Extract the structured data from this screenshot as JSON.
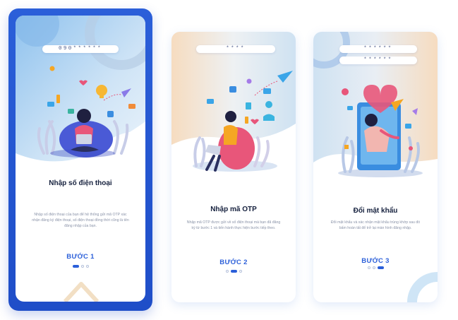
{
  "colors": {
    "accent": "#2b5fd9",
    "title": "#16213e",
    "muted": "#8a93a8"
  },
  "steps": [
    {
      "input_value": "090******",
      "title": "Nhập số điện thoại",
      "description": "Nhập số điện thoại của bạn để hệ thống gửi mã OTP xác nhận đăng ký điện thoại, số điện thoại đồng thời cũng là tên đăng nhập của bạn.",
      "step_label": "BƯỚC 1",
      "active_dot": 0
    },
    {
      "input_value": "****",
      "title": "Nhập mã OTP",
      "description": "Nhập mã OTP được gửi về số điện thoại mà bạn đã đăng ký từ bước 1 và tiến hành thực hiện bước tiếp theo.",
      "step_label": "BƯỚC 2",
      "active_dot": 1
    },
    {
      "input_values": [
        "******",
        "******"
      ],
      "title": "Đổi mật khẩu",
      "description": "Đổi mật khẩu và xác nhận mật khẩu trùng khớp sau đó bấm hoàn tất để trở lại màn hình đăng nhập.",
      "step_label": "BƯỚC 3",
      "active_dot": 2
    }
  ]
}
